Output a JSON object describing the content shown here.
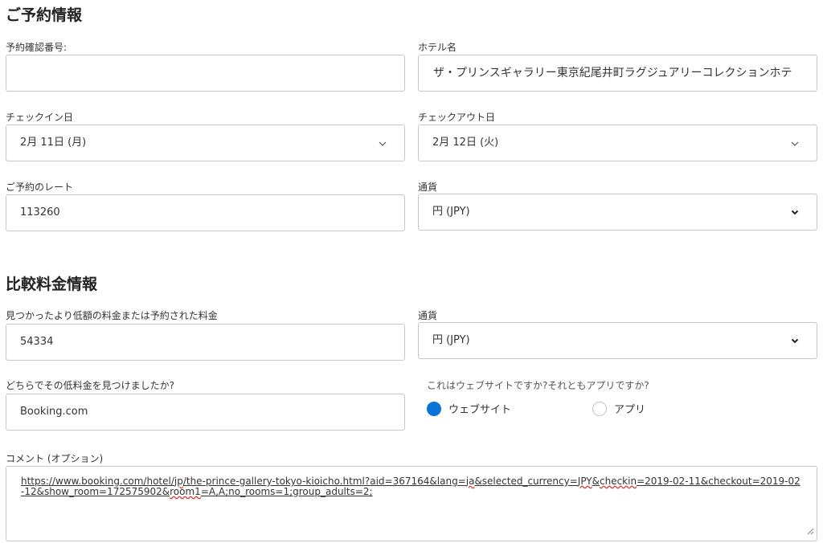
{
  "reservation": {
    "title": "ご予約情報",
    "confirmation_label": "予約確認番号:",
    "confirmation_value": "",
    "hotel_label": "ホテル名",
    "hotel_value": "ザ・プリンスギャラリー東京紀尾井町ラグジュアリーコレクションホテ",
    "checkin_label": "チェックイン日",
    "checkin_value": "2月 11日 (月)",
    "checkout_label": "チェックアウト日",
    "checkout_value": "2月 12日 (火)",
    "rate_label": "ご予約のレート",
    "rate_value": "113260",
    "currency_label": "通貨",
    "currency_value": "円 (JPY)"
  },
  "comparison": {
    "title": "比較料金情報",
    "lower_rate_label": "見つかったより低額の料金または予約された料金",
    "lower_rate_value": "54334",
    "currency_label": "通貨",
    "currency_value": "円 (JPY)",
    "where_label": "どちらでその低料金を見つけましたか?",
    "where_value": "Booking.com",
    "site_or_app_label": "これはウェブサイトですか?それともアプリですか?",
    "option_website": "ウェブサイト",
    "option_app": "アプリ",
    "selected_option": "website"
  },
  "comment": {
    "label": "コメント (オプション)",
    "parts": [
      "https://www.booking.com/hotel/",
      "jp",
      "/the-prince-gallery-tokyo-kioicho.html?aid=367164&lang=",
      "ja",
      "&selected_currency=",
      "JPY",
      "&",
      "checkin",
      "=2019-02-11&checkout=2019-02-12&show_room=172575902&",
      "room1",
      "=A,A;no_rooms=1;group_adults=2;"
    ]
  },
  "colors": {
    "accent": "#0a74d6",
    "border": "#c7c7c7",
    "spellcheck": "#d92a2a"
  },
  "icons": {
    "select_chevron": "chevron-down-icon",
    "resize": "resize-handle-icon"
  }
}
